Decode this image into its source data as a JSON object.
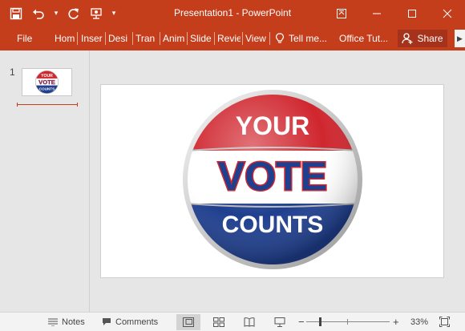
{
  "window": {
    "title": "Presentation1 - PowerPoint",
    "accent": "#c43e1c"
  },
  "qat": {
    "icons": [
      "save-icon",
      "undo-icon",
      "redo-icon",
      "from-beginning-icon",
      "customize-qat-icon"
    ]
  },
  "ribbon": {
    "tabs": [
      "File",
      "Hom",
      "Inser",
      "Desi",
      "Tran",
      "Anim",
      "Slide",
      "Revie",
      "View"
    ],
    "tell_me": "Tell me...",
    "office_tut": "Office Tut...",
    "share": "Share"
  },
  "thumbnails": {
    "slide_number": "1"
  },
  "slide": {
    "badge_line1": "YOUR",
    "badge_line2": "VOTE",
    "badge_line3": "COUNTS",
    "colors": {
      "red": "#d0262e",
      "blue": "#1f3f8f",
      "white": "#ffffff"
    }
  },
  "statusbar": {
    "notes": "Notes",
    "comments": "Comments",
    "zoom_minus": "−",
    "zoom_plus": "+",
    "zoom_level": "33%"
  }
}
